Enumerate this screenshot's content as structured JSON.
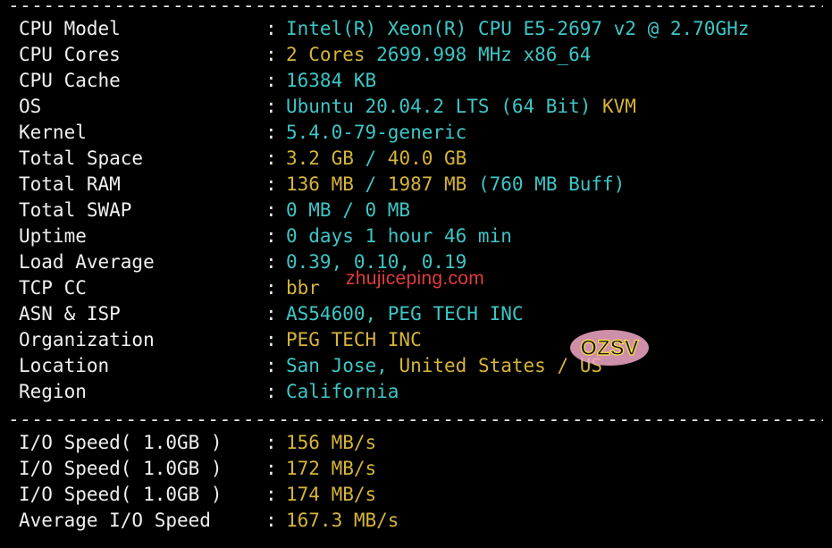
{
  "separator": "--------------------------------------------------------------------------------------------",
  "sysinfo": [
    {
      "label": "CPU Model",
      "parts": [
        {
          "t": "Intel(R) Xeon(R) CPU E5-2697 v2 @ 2.70GHz",
          "c": "c"
        }
      ]
    },
    {
      "label": "CPU Cores",
      "parts": [
        {
          "t": "2 Cores",
          "c": "y"
        },
        {
          "t": " 2699.998 MHz x86_64",
          "c": "c"
        }
      ]
    },
    {
      "label": "CPU Cache",
      "parts": [
        {
          "t": "16384 KB",
          "c": "c"
        }
      ]
    },
    {
      "label": "OS",
      "parts": [
        {
          "t": "Ubuntu 20.04.2 LTS (64 Bit) ",
          "c": "c"
        },
        {
          "t": "KVM",
          "c": "y"
        }
      ]
    },
    {
      "label": "Kernel",
      "parts": [
        {
          "t": "5.4.0-79-generic",
          "c": "c"
        }
      ]
    },
    {
      "label": "Total Space",
      "parts": [
        {
          "t": "3.2 GB",
          "c": "y"
        },
        {
          "t": " / ",
          "c": "c"
        },
        {
          "t": "40.0 GB",
          "c": "y"
        }
      ]
    },
    {
      "label": "Total RAM",
      "parts": [
        {
          "t": "136 MB",
          "c": "y"
        },
        {
          "t": " / ",
          "c": "c"
        },
        {
          "t": "1987 MB",
          "c": "y"
        },
        {
          "t": " (760 MB Buff)",
          "c": "c"
        }
      ]
    },
    {
      "label": "Total SWAP",
      "parts": [
        {
          "t": "0 MB / 0 MB",
          "c": "c"
        }
      ]
    },
    {
      "label": "Uptime",
      "parts": [
        {
          "t": "0 days 1 hour 46 min",
          "c": "c"
        }
      ]
    },
    {
      "label": "Load Average",
      "parts": [
        {
          "t": "0.39, 0.10, 0.19",
          "c": "c"
        }
      ]
    },
    {
      "label": "TCP CC",
      "parts": [
        {
          "t": "bbr",
          "c": "y"
        }
      ]
    },
    {
      "label": "ASN & ISP",
      "parts": [
        {
          "t": "AS54600, PEG TECH INC",
          "c": "c"
        }
      ]
    },
    {
      "label": "Organization",
      "parts": [
        {
          "t": "PEG TECH INC",
          "c": "y"
        }
      ]
    },
    {
      "label": "Location",
      "parts": [
        {
          "t": "San Jose, ",
          "c": "c"
        },
        {
          "t": "United States / US",
          "c": "y"
        }
      ]
    },
    {
      "label": "Region",
      "parts": [
        {
          "t": "California",
          "c": "c"
        }
      ]
    }
  ],
  "io": [
    {
      "label": "I/O Speed( 1.0GB )",
      "parts": [
        {
          "t": "156 MB/s",
          "c": "y"
        }
      ]
    },
    {
      "label": "I/O Speed( 1.0GB )",
      "parts": [
        {
          "t": "172 MB/s",
          "c": "y"
        }
      ]
    },
    {
      "label": "I/O Speed( 1.0GB )",
      "parts": [
        {
          "t": "174 MB/s",
          "c": "y"
        }
      ]
    },
    {
      "label": "Average I/O Speed",
      "parts": [
        {
          "t": "167.3 MB/s",
          "c": "y"
        }
      ]
    }
  ],
  "colon": ":",
  "watermark": "zhujiceping.com",
  "logo_text": "OZSV",
  "colors": {
    "background": "#000000",
    "cyan": "#3ec6c6",
    "yellow": "#d6b43c",
    "white": "#e8e8e8",
    "watermark": "#e23b3b"
  }
}
